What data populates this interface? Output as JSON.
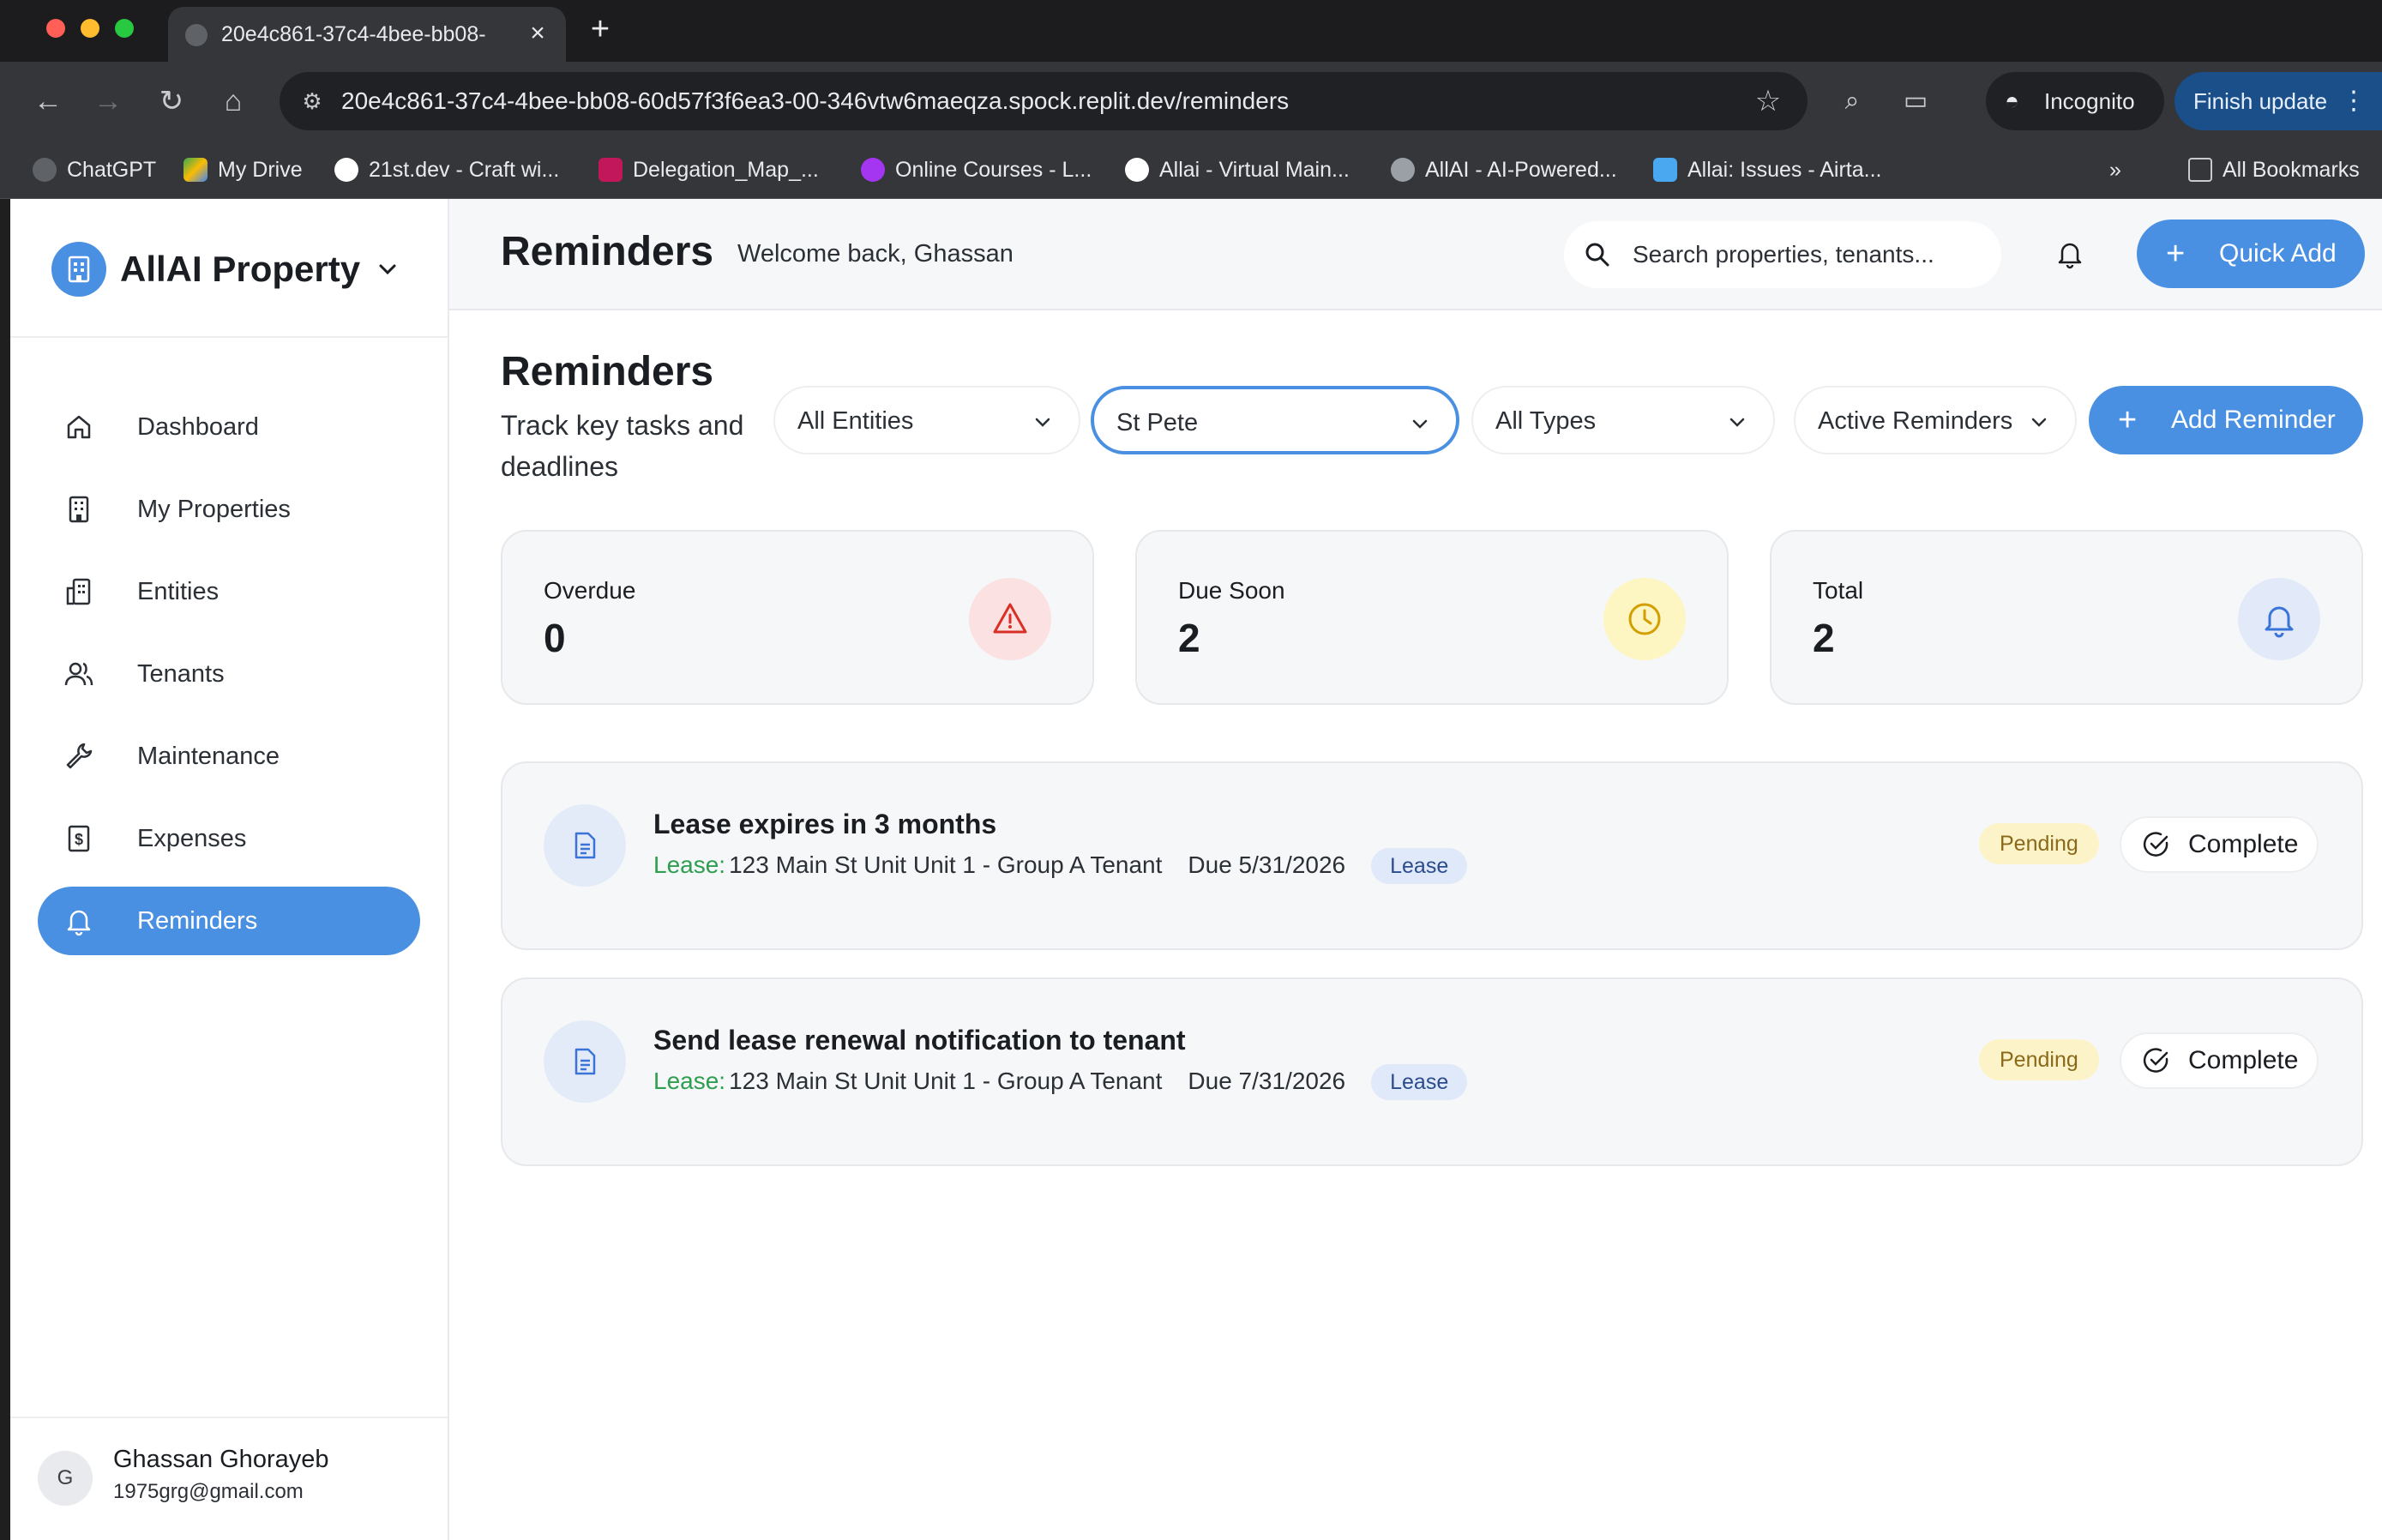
{
  "browser": {
    "tab_title": "20e4c861-37c4-4bee-bb08-",
    "url": "20e4c861-37c4-4bee-bb08-60d57f3f6ea3-00-346vtw6maeqza.spock.replit.dev/reminders",
    "incognito_label": "Incognito",
    "finish_update_label": "Finish update",
    "bookmarks": [
      {
        "label": "ChatGPT",
        "icon": "chatgpt-icon",
        "color": "#e8eaed"
      },
      {
        "label": "My Drive",
        "icon": "google-drive-icon",
        "color": "#34a853"
      },
      {
        "label": "21st.dev - Craft wi...",
        "icon": "21st-icon",
        "color": "#ffffff"
      },
      {
        "label": "Delegation_Map_...",
        "icon": "de-icon",
        "color": "#c2185b"
      },
      {
        "label": "Online Courses - L...",
        "icon": "udemy-icon",
        "color": "#a435f0"
      },
      {
        "label": "Allai - Virtual Main...",
        "icon": "triangle-icon",
        "color": "#ffffff"
      },
      {
        "label": "AllAI - AI-Powered...",
        "icon": "globe-icon",
        "color": "#9aa0a6"
      },
      {
        "label": "Allai: Issues - Airta...",
        "icon": "ai-icon",
        "color": "#4aa8f0"
      }
    ],
    "all_bookmarks_label": "All Bookmarks"
  },
  "app": {
    "brand": "AllAI Property",
    "nav": [
      {
        "label": "Dashboard",
        "icon": "home-icon"
      },
      {
        "label": "My Properties",
        "icon": "building-icon"
      },
      {
        "label": "Entities",
        "icon": "entities-icon"
      },
      {
        "label": "Tenants",
        "icon": "users-icon"
      },
      {
        "label": "Maintenance",
        "icon": "wrench-icon"
      },
      {
        "label": "Expenses",
        "icon": "receipt-icon"
      },
      {
        "label": "Reminders",
        "icon": "bell-icon",
        "active": true
      }
    ],
    "user": {
      "initial": "G",
      "name": "Ghassan Ghorayeb",
      "email": "1975grg@gmail.com"
    }
  },
  "header": {
    "title": "Reminders",
    "welcome": "Welcome back, Ghassan",
    "search_placeholder": "Search properties, tenants...",
    "quick_add_label": "Quick Add"
  },
  "main": {
    "title": "Reminders",
    "subtitle": "Track key tasks and deadlines",
    "filters": {
      "entities": "All Entities",
      "property": "St Pete",
      "types": "All Types",
      "status": "Active Reminders"
    },
    "add_reminder_label": "Add Reminder",
    "stats": [
      {
        "label": "Overdue",
        "value": "0",
        "icon": "warning-icon",
        "icon_color": "#d93025",
        "bg": "#fbe1e1"
      },
      {
        "label": "Due Soon",
        "value": "2",
        "icon": "clock-icon",
        "icon_color": "#d39e00",
        "bg": "#fdf6c3"
      },
      {
        "label": "Total",
        "value": "2",
        "icon": "bell-icon",
        "icon_color": "#3b74d9",
        "bg": "#e2eafa"
      }
    ],
    "reminders": [
      {
        "title": "Lease expires in 3 months",
        "type_label": "Lease:",
        "property": "123 Main St Unit Unit 1 - Group A Tenant",
        "due": "Due 5/31/2026",
        "tag": "Lease",
        "status": "Pending",
        "action": "Complete"
      },
      {
        "title": "Send lease renewal notification to tenant",
        "type_label": "Lease:",
        "property": "123 Main St Unit Unit 1 - Group A Tenant",
        "due": "Due 7/31/2026",
        "tag": "Lease",
        "status": "Pending",
        "action": "Complete"
      }
    ]
  },
  "colors": {
    "accent": "#4a90e2",
    "pending_bg": "#fdf3c9",
    "lease_green": "#2e9e4f"
  }
}
